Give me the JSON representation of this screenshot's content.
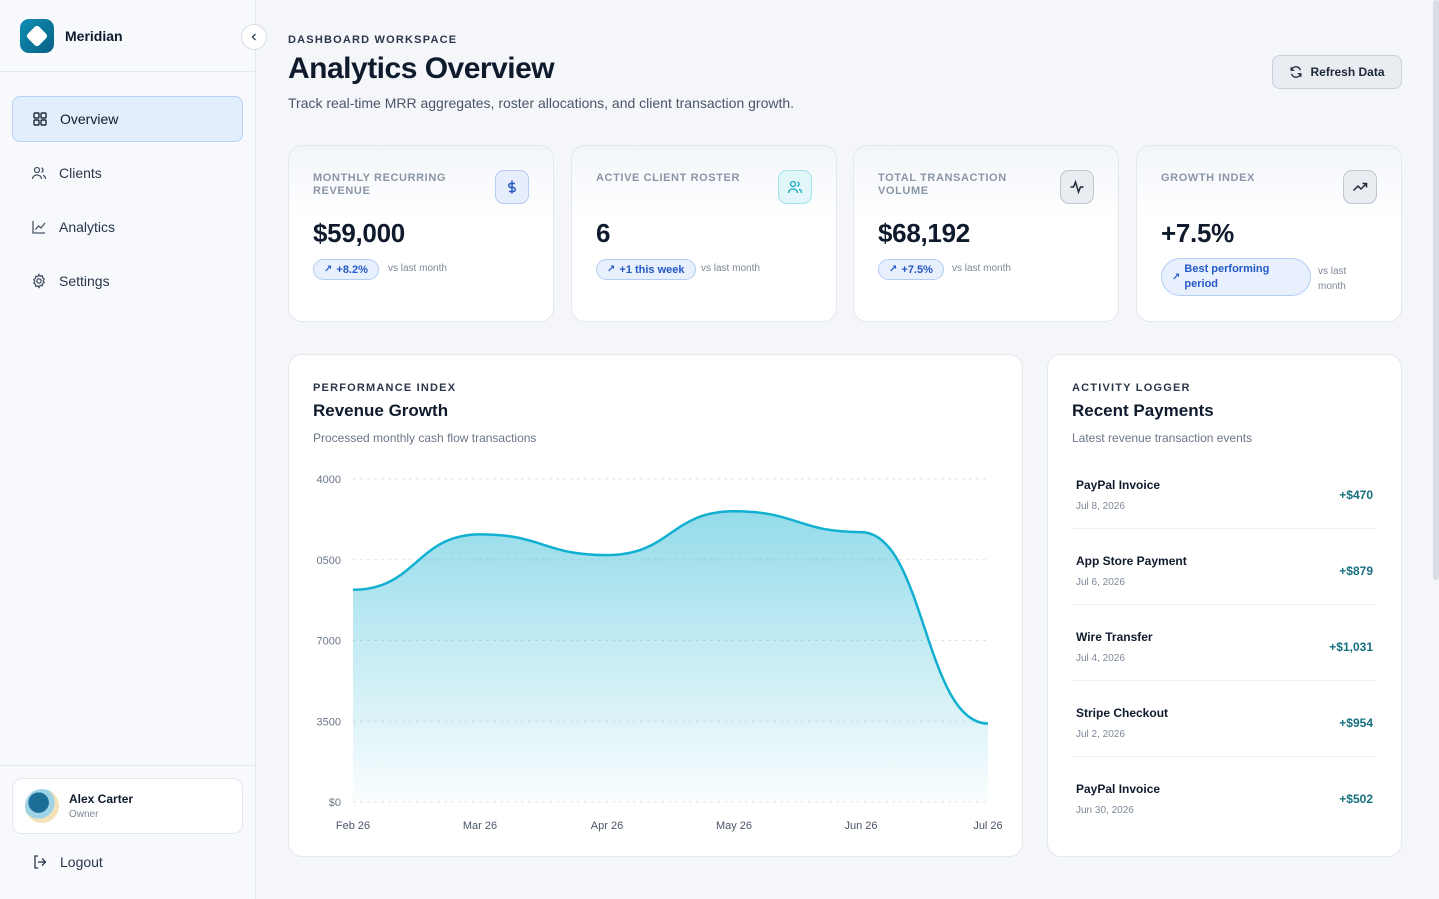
{
  "brand": {
    "name": "Meridian"
  },
  "sidebar": {
    "items": [
      {
        "label": "Overview",
        "icon": "grid-icon"
      },
      {
        "label": "Clients",
        "icon": "users-icon"
      },
      {
        "label": "Analytics",
        "icon": "line-chart-icon"
      },
      {
        "label": "Settings",
        "icon": "gear-icon"
      }
    ],
    "active": "Overview",
    "user": {
      "name": "Alex Carter",
      "role": "Owner"
    },
    "logout_label": "Logout"
  },
  "header": {
    "eyebrow": "DASHBOARD WORKSPACE",
    "title": "Analytics Overview",
    "subtitle": "Track real-time MRR aggregates, roster allocations, and client transaction growth.",
    "refresh_label": "Refresh Data"
  },
  "kpis": [
    {
      "label": "MONTHLY RECURRING REVENUE",
      "value": "$59,000",
      "badge": "+8.2%",
      "note": "vs last month",
      "icon": "dollar-icon",
      "accent": "#2459c6"
    },
    {
      "label": "ACTIVE CLIENT ROSTER",
      "value": "6",
      "badge": "+1 this week",
      "note": "vs last month",
      "icon": "users-icon",
      "accent": "#1aa7c4"
    },
    {
      "label": "TOTAL TRANSACTION VOLUME",
      "value": "$68,192",
      "badge": "+7.5%",
      "note": "vs last month",
      "icon": "activity-icon",
      "accent": "#1c2838"
    },
    {
      "label": "GROWTH INDEX",
      "value": "+7.5%",
      "badge_line1": "Best performing",
      "badge_line2": "period",
      "note_line1": "vs last",
      "note_line2": "month",
      "icon": "trending-up-icon",
      "accent": "#1c2838"
    }
  ],
  "revenue_panel": {
    "eyebrow": "PERFORMANCE INDEX",
    "title": "Revenue Growth",
    "subtitle": "Processed monthly cash flow transactions"
  },
  "chart_data": {
    "type": "area",
    "x": [
      "Feb 26",
      "Mar 26",
      "Apr 26",
      "May 26",
      "Jun 26",
      "Jul 26"
    ],
    "y_tick_labels": [
      "$0",
      "3500",
      "7000",
      "0500",
      "4000"
    ],
    "y_tick_values": [
      0,
      3500,
      7000,
      10500,
      14000
    ],
    "ylim": [
      0,
      14000
    ],
    "series": [
      {
        "values": [
          9200,
          11600,
          10700,
          12600,
          11700,
          3400
        ]
      }
    ],
    "color": "#12b0d0",
    "grid": true
  },
  "payments_panel": {
    "eyebrow": "ACTIVITY LOGGER",
    "title": "Recent Payments",
    "subtitle": "Latest revenue transaction events",
    "items": [
      {
        "name": "PayPal Invoice",
        "date": "Jul 8, 2026",
        "amount": "+$470"
      },
      {
        "name": "App Store Payment",
        "date": "Jul 6, 2026",
        "amount": "+$879"
      },
      {
        "name": "Wire Transfer",
        "date": "Jul 4, 2026",
        "amount": "+$1,031"
      },
      {
        "name": "Stripe Checkout",
        "date": "Jul 2, 2026",
        "amount": "+$954"
      },
      {
        "name": "PayPal Invoice",
        "date": "Jun 30, 2026",
        "amount": "+$502"
      }
    ]
  }
}
